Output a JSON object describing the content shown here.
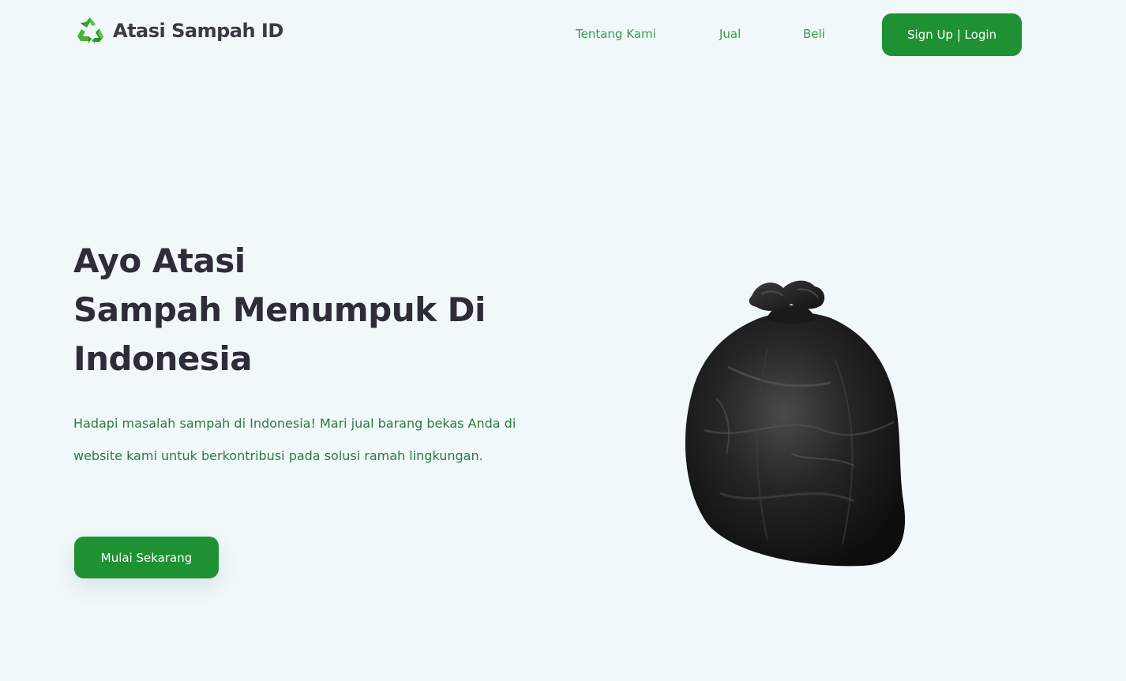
{
  "colors": {
    "background": "#f1f8fa",
    "primary_green": "#1e9232",
    "nav_link": "#3d9a4b",
    "heading": "#2e2c38",
    "body_text": "#2c7a3e"
  },
  "navbar": {
    "logo_icon": "recycle-icon",
    "brand_name": "Atasi Sampah ID",
    "links": [
      "Tentang Kami",
      "Jual",
      "Beli"
    ],
    "auth_button": "Sign Up | Login"
  },
  "hero": {
    "title_lines": [
      "Ayo Atasi",
      "Sampah Menumpuk Di",
      "Indonesia"
    ],
    "description": "Hadapi masalah sampah di Indonesia! Mari jual barang bekas Anda di website kami untuk berkontribusi pada solusi ramah lingkungan.",
    "cta_button": "Mulai Sekarang",
    "image": "black-garbage-bag"
  }
}
